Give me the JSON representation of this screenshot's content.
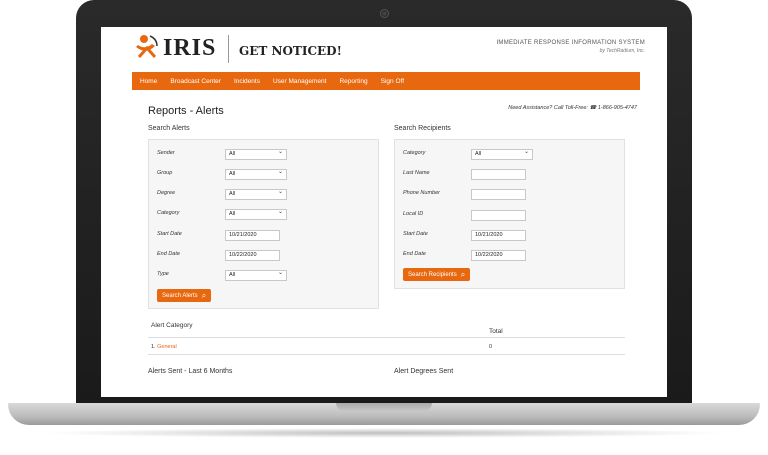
{
  "header": {
    "logo_text": "IRIS",
    "tagline": "GET NOTICED!",
    "system_name": "IMMEDIATE RESPONSE INFORMATION SYSTEM",
    "system_by": "by TechRadium, Inc."
  },
  "nav": {
    "items": [
      "Home",
      "Broadcast Center",
      "Incidents",
      "User Management",
      "Reporting",
      "Sign Off"
    ]
  },
  "page": {
    "title": "Reports - Alerts",
    "assistance": "Need Assistance? Call Toll-Free:",
    "phone": "1-866-905-4747"
  },
  "search_alerts": {
    "title": "Search Alerts",
    "fields": [
      {
        "label": "Sender",
        "value": "All"
      },
      {
        "label": "Group",
        "value": "All"
      },
      {
        "label": "Degree",
        "value": "All"
      },
      {
        "label": "Category",
        "value": "All"
      },
      {
        "label": "Start Date",
        "value": "10/21/2020"
      },
      {
        "label": "End Date",
        "value": "10/22/2020"
      },
      {
        "label": "Type",
        "value": "All"
      }
    ],
    "button": "Search Alerts"
  },
  "search_recipients": {
    "title": "Search Recipients",
    "fields": [
      {
        "label": "Category",
        "value": "All"
      },
      {
        "label": "Last Name",
        "value": ""
      },
      {
        "label": "Phone Number",
        "value": ""
      },
      {
        "label": "Local ID",
        "value": ""
      },
      {
        "label": "Start Date",
        "value": "10/21/2020"
      },
      {
        "label": "End Date",
        "value": "10/22/2020"
      }
    ],
    "button": "Search Recipients"
  },
  "category_table": {
    "col_category": "Alert Category",
    "col_total": "Total",
    "rows": [
      {
        "index": "1.",
        "name": "General",
        "total": "0"
      }
    ]
  },
  "bottom": {
    "alerts_sent": "Alerts Sent - Last 6 Months",
    "degrees_sent": "Alert Degrees Sent"
  },
  "colors": {
    "accent": "#e8680f"
  }
}
